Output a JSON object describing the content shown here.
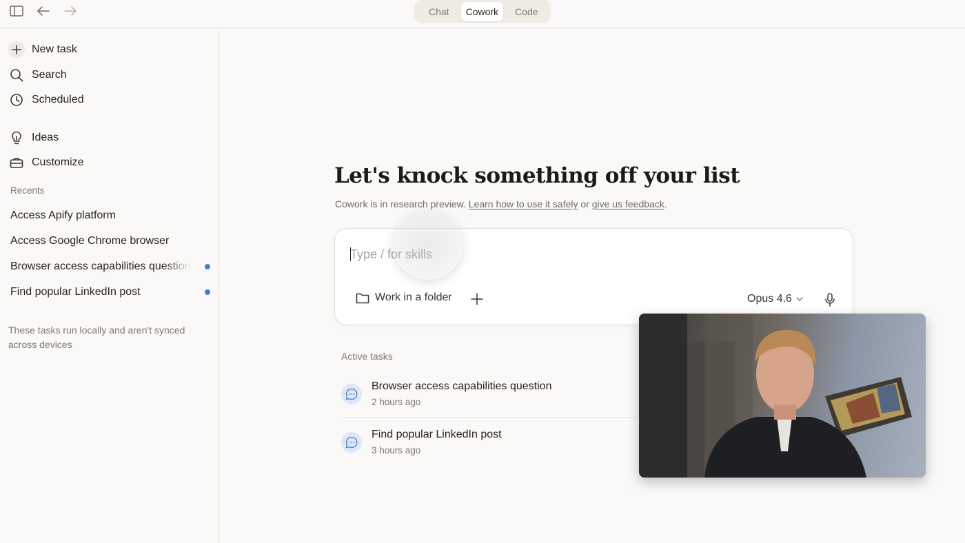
{
  "topbar": {
    "tabs": [
      {
        "label": "Chat",
        "active": false
      },
      {
        "label": "Cowork",
        "active": true
      },
      {
        "label": "Code",
        "active": false
      }
    ]
  },
  "sidebar": {
    "nav": [
      {
        "label": "New task",
        "icon": "plus-icon"
      },
      {
        "label": "Search",
        "icon": "search-icon"
      },
      {
        "label": "Scheduled",
        "icon": "clock-icon"
      },
      {
        "label": "Ideas",
        "icon": "lightbulb-icon"
      },
      {
        "label": "Customize",
        "icon": "toolbox-icon"
      }
    ],
    "recents_label": "Recents",
    "recents": [
      {
        "label": "Access Apify platform",
        "unread": false
      },
      {
        "label": "Access Google Chrome browser",
        "unread": false
      },
      {
        "label": "Browser access capabilities question",
        "unread": true
      },
      {
        "label": "Find popular LinkedIn post",
        "unread": true
      }
    ],
    "sync_note": "These tasks run locally and aren't synced across devices"
  },
  "main": {
    "headline": "Let's knock something off your list",
    "subline_prefix": "Cowork is in research preview. ",
    "subline_link1": "Learn how to use it safely",
    "subline_mid": " or ",
    "subline_link2": "give us feedback",
    "subline_suffix": ".",
    "composer": {
      "placeholder": "Type / for skills",
      "value": "",
      "folder_label": "Work in a folder",
      "model_label": "Opus 4.6"
    },
    "active_tasks_label": "Active tasks",
    "active_tasks": [
      {
        "title": "Browser access capabilities question",
        "time": "2 hours ago"
      },
      {
        "title": "Find popular LinkedIn post",
        "time": "3 hours ago"
      }
    ]
  },
  "colors": {
    "background": "#faf9f7",
    "unread_dot": "#3b82d6",
    "task_icon_bg": "#dce8f6"
  }
}
